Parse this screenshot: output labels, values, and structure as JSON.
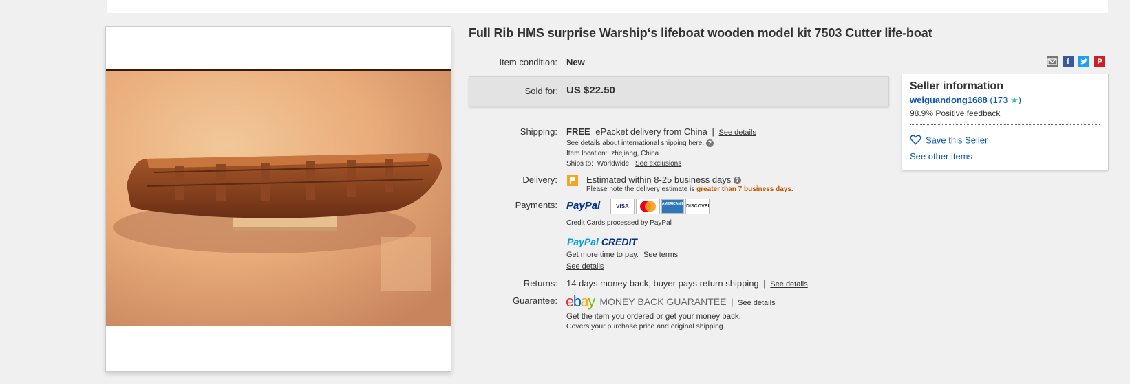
{
  "item": {
    "title": "Full Rib HMS surprise Warship‘s lifeboat wooden model kit 7503 Cutter life-boat",
    "condition_label": "Item condition:",
    "condition": "New",
    "sold_label": "Sold for:",
    "price": "US $22.50"
  },
  "shipping": {
    "label": "Shipping:",
    "free": "FREE",
    "method": "ePacket delivery from China",
    "see_details": "See details",
    "intl_note": "See details about international shipping here.",
    "location_label": "Item location:",
    "location": "zhejiang, China",
    "ships_to_label": "Ships to:",
    "ships_to": "Worldwide",
    "see_exclusions": "See exclusions"
  },
  "delivery": {
    "label": "Delivery:",
    "estimate": "Estimated within 8-25 business days",
    "note_prefix": "Please note the delivery estimate is",
    "note_highlight": "greater than 7 business days."
  },
  "payments": {
    "label": "Payments:",
    "paypal": "PayPal",
    "cards": [
      "VISA",
      "MasterCard",
      "AMERICAN EXPRESS",
      "DISCOVER"
    ],
    "cards_note": "Credit Cards processed by PayPal",
    "credit_logo_a": "PayPal",
    "credit_logo_b": "CREDIT",
    "credit_text": "Get more time to pay.",
    "see_terms": "See terms",
    "see_details": "See details"
  },
  "returns": {
    "label": "Returns:",
    "text": "14 days money back, buyer pays return shipping",
    "see_details": "See details"
  },
  "guarantee": {
    "label": "Guarantee:",
    "ebay_letters": [
      "e",
      "b",
      "a",
      "y"
    ],
    "mbg": "MONEY BACK GUARANTEE",
    "see_details": "See details",
    "line1": "Get the item you ordered or get your money back.",
    "line2": "Covers your purchase price and original shipping."
  },
  "seller": {
    "heading": "Seller information",
    "name": "weiguandong1688",
    "score_open": "(173",
    "score_close": ")",
    "feedback": "98.9% Positive feedback",
    "save": "Save this Seller",
    "other": "See other items"
  },
  "share_icons": [
    "email-icon",
    "facebook-icon",
    "twitter-icon",
    "pinterest-icon"
  ],
  "colors": {
    "link": "#0654ba",
    "highlight": "#c45500",
    "star": "#3fbfa6",
    "ebay_e": "#e53238",
    "ebay_b": "#0064d2",
    "ebay_a": "#f5af02",
    "ebay_y": "#86b817"
  }
}
